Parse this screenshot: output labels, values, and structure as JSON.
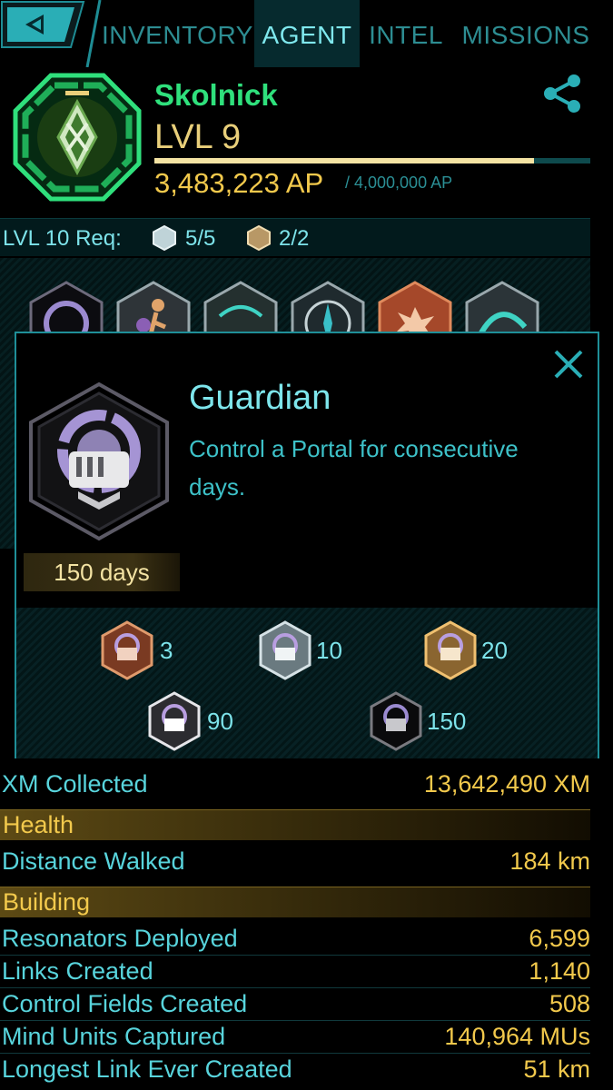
{
  "nav": {
    "tabs": [
      "INVENTORY",
      "AGENT",
      "INTEL",
      "MISSIONS"
    ],
    "active_tab": "AGENT"
  },
  "agent": {
    "name": "Skolnick",
    "level": "LVL 9",
    "ap_current": "3,483,223 AP",
    "ap_max": "/ 4,000,000 AP",
    "ap_progress": 0.871
  },
  "requirements": {
    "label": "LVL 10 Req:",
    "silver": "5/5",
    "gold": "2/2"
  },
  "modal": {
    "title": "Guardian",
    "description": "Control a Portal for consecutive days.",
    "progress_label": "150 days",
    "tiers": [
      {
        "name": "bronze",
        "value": "3"
      },
      {
        "name": "silver",
        "value": "10"
      },
      {
        "name": "gold",
        "value": "20"
      },
      {
        "name": "platinum",
        "value": "90"
      },
      {
        "name": "onyx",
        "value": "150"
      }
    ]
  },
  "stats": {
    "xm_collected": {
      "label": "XM Collected",
      "value": "13,642,490 XM"
    },
    "health_section": "Health",
    "distance_walked": {
      "label": "Distance Walked",
      "value": "184 km"
    },
    "building_section": "Building",
    "resonators_deployed": {
      "label": "Resonators Deployed",
      "value": "6,599"
    },
    "links_created": {
      "label": "Links Created",
      "value": "1,140"
    },
    "control_fields_created": {
      "label": "Control Fields Created",
      "value": "508"
    },
    "mind_units_captured": {
      "label": "Mind Units Captured",
      "value": "140,964 MUs"
    },
    "longest_link": {
      "label": "Longest Link Ever Created",
      "value": "51 km"
    }
  },
  "colors": {
    "accent_cyan": "#5ad2d8",
    "gold": "#f2c94c",
    "enlightened_green": "#2fe07c"
  }
}
